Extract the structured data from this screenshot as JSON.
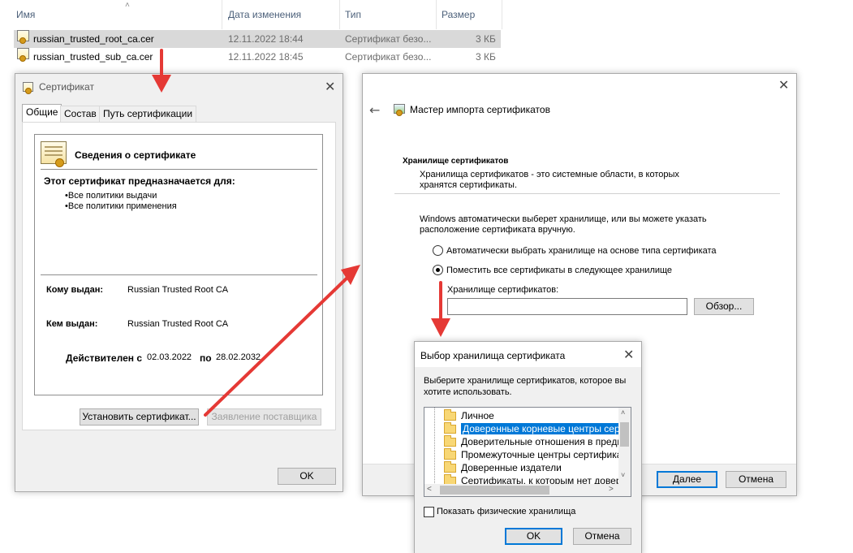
{
  "explorer": {
    "columns": [
      "Имя",
      "Дата изменения",
      "Тип",
      "Размер"
    ],
    "files": [
      {
        "name": "russian_trusted_root_ca.cer",
        "date": "12.11.2022 18:44",
        "type": "Сертификат безо...",
        "size": "3 КБ"
      },
      {
        "name": "russian_trusted_sub_ca.cer",
        "date": "12.11.2022 18:45",
        "type": "Сертификат безо...",
        "size": "3 КБ"
      }
    ]
  },
  "certificate": {
    "title": "Сертификат",
    "tabs": [
      "Общие",
      "Состав",
      "Путь сертификации"
    ],
    "info_heading": "Сведения о сертификате",
    "purpose_heading": "Этот сертификат предназначается для:",
    "purposes": [
      "•Все политики выдачи",
      "•Все политики применения"
    ],
    "issued_to_label": "Кому выдан:",
    "issued_to": "Russian Trusted Root CA",
    "issued_by_label": "Кем выдан:",
    "issued_by": "Russian Trusted Root CA",
    "valid_from_label": "Действителен с",
    "valid_from": "02.03.2022",
    "valid_to_label": "по",
    "valid_to": "28.02.2032",
    "install_button": "Установить сертификат...",
    "issuer_statement_button": "Заявление поставщика",
    "ok_button": "OK"
  },
  "wizard": {
    "title": "Мастер импорта сертификатов",
    "section_title": "Хранилище сертификатов",
    "section_desc_1": "Хранилища сертификатов - это системные области, в которых",
    "section_desc_2": "хранятся сертификаты.",
    "auto_text_1": "Windows автоматически выберет хранилище, или вы можете указать",
    "auto_text_2": "расположение сертификата вручную.",
    "radio_auto": "Автоматически выбрать хранилище на основе типа сертификата",
    "radio_manual": "Поместить все сертификаты в следующее хранилище",
    "store_label": "Хранилище сертификатов:",
    "store_value": "",
    "browse_button": "Обзор...",
    "next_button": "Далее",
    "cancel_button": "Отмена"
  },
  "store_dialog": {
    "title": "Выбор хранилища сертификата",
    "prompt_1": "Выберите хранилище сертификатов, которое вы",
    "prompt_2": "хотите использовать.",
    "stores": [
      "Личное",
      "Доверенные корневые центры сертио",
      "Доверительные отношения в предпри",
      "Промежуточные центры сертификаци",
      "Доверенные издатели",
      "Сертификаты, к которым нет довери"
    ],
    "selected_index": 1,
    "show_physical_label": "Показать физические хранилища",
    "show_physical_checked": false,
    "ok_button": "OK",
    "cancel_button": "Отмена"
  },
  "colors": {
    "accent": "#0078d7",
    "annotation_arrow": "#e53935"
  }
}
